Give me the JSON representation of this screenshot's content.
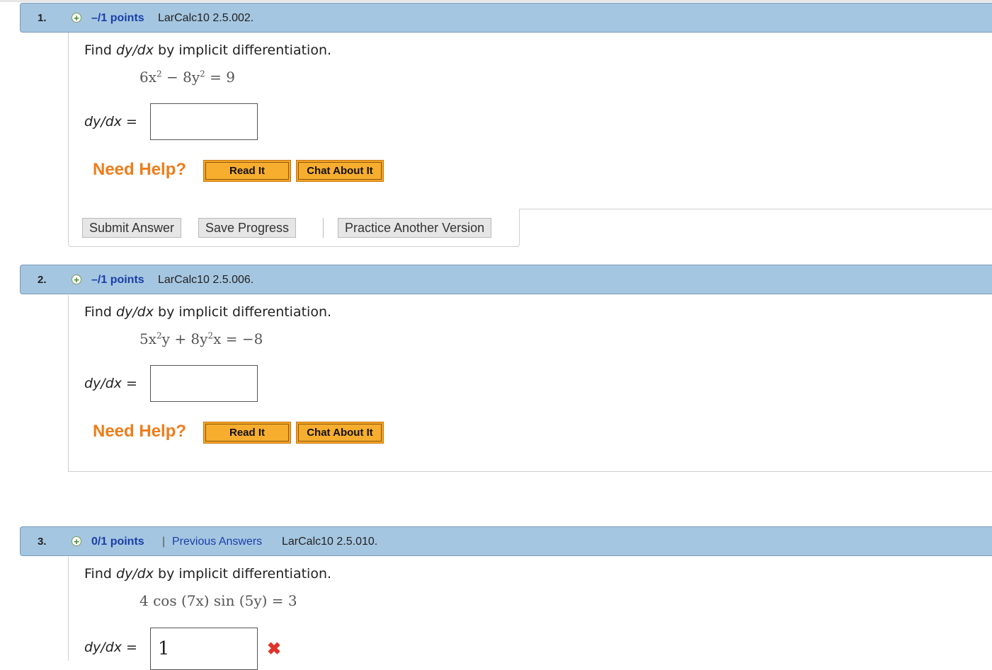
{
  "questions": [
    {
      "number": "1.",
      "points": "–/1 points",
      "id": "LarCalc10 2.5.002.",
      "prompt_pre": "Find ",
      "prompt_var": "dy/dx",
      "prompt_post": " by implicit differentiation.",
      "equation": {
        "a": "6x",
        "b": " − 8y",
        "c": " = 9"
      },
      "answer_label": "dy/dx",
      "answer_eq": " =",
      "answer_value": "",
      "need_help": "Need Help?",
      "read_it": "Read It",
      "chat_about_it": "Chat About It"
    },
    {
      "number": "2.",
      "points": "–/1 points",
      "id": "LarCalc10 2.5.006.",
      "prompt_pre": "Find ",
      "prompt_var": "dy/dx",
      "prompt_post": " by implicit differentiation.",
      "equation": {
        "a": "5x",
        "b": "y + 8y",
        "c": "x = −8"
      },
      "answer_label": "dy/dx",
      "answer_eq": " =",
      "answer_value": "",
      "need_help": "Need Help?",
      "read_it": "Read It",
      "chat_about_it": "Chat About It"
    },
    {
      "number": "3.",
      "points": "0/1 points",
      "separator": "|",
      "previous_answers": "Previous Answers",
      "id": "LarCalc10 2.5.010.",
      "prompt_pre": "Find ",
      "prompt_var": "dy/dx",
      "prompt_post": " by implicit differentiation.",
      "equation_text": "4 cos (7x) sin (5y) = 3",
      "answer_label": "dy/dx",
      "answer_eq": " =",
      "answer_value": "1"
    }
  ],
  "superscript": "2",
  "actions": {
    "submit": "Submit Answer",
    "save": "Save Progress",
    "practice": "Practice Another Version"
  },
  "icons": {
    "expand": "plus-circle-icon",
    "incorrect": "x-mark-icon"
  },
  "colors": {
    "header_bar": "#a5c6e1",
    "link": "#1a3ea8",
    "help": "#ee7d1a",
    "help_button": "#f5a323",
    "wrong": "#e0332a"
  }
}
